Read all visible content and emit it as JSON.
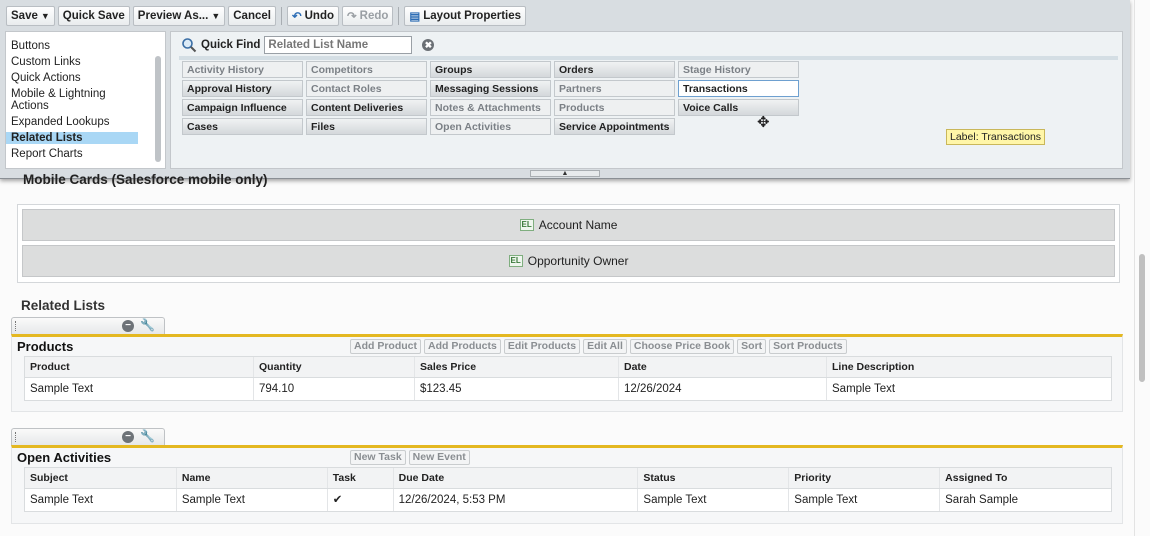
{
  "toolbar": {
    "save": "Save",
    "quick_save": "Quick Save",
    "preview_as": "Preview As...",
    "cancel": "Cancel",
    "undo": "Undo",
    "redo": "Redo",
    "layout_properties": "Layout Properties"
  },
  "palette": {
    "categories": [
      "Buttons",
      "Custom Links",
      "Quick Actions",
      "Mobile & Lightning Actions",
      "Expanded Lookups",
      "Related Lists",
      "Report Charts"
    ],
    "selected_category": "Related Lists",
    "quick_find_label": "Quick Find",
    "quick_find_placeholder": "Related List Name",
    "items": [
      [
        "Activity History",
        "Competitors",
        "Groups",
        "Orders",
        "Stage History"
      ],
      [
        "Approval History",
        "Contact Roles",
        "Messaging Sessions",
        "Partners",
        "Transactions"
      ],
      [
        "Campaign Influence",
        "Content Deliveries",
        "Notes & Attachments",
        "Products",
        "Voice Calls"
      ],
      [
        "Cases",
        "Files",
        "Open Activities",
        "Service Appointments",
        ""
      ]
    ],
    "item_states": [
      [
        "used",
        "used",
        "avail",
        "avail",
        "used"
      ],
      [
        "avail",
        "used",
        "avail",
        "used",
        "active"
      ],
      [
        "avail",
        "avail",
        "used",
        "used",
        "avail"
      ],
      [
        "avail",
        "avail",
        "used",
        "avail",
        ""
      ]
    ],
    "tooltip": "Label: Transactions"
  },
  "mobile_cards": {
    "title": "Mobile Cards (Salesforce mobile only)",
    "fields": [
      "Account Name",
      "Opportunity Owner"
    ],
    "field_icon": "EL"
  },
  "related_lists": {
    "title": "Related Lists",
    "products": {
      "name": "Products",
      "buttons": [
        "Add Product",
        "Add Products",
        "Edit Products",
        "Edit All",
        "Choose Price Book",
        "Sort",
        "Sort Products"
      ],
      "columns": [
        "Product",
        "Quantity",
        "Sales Price",
        "Date",
        "Line Description"
      ],
      "row": [
        "Sample Text",
        "794.10",
        "$123.45",
        "12/26/2024",
        "Sample Text"
      ]
    },
    "open_activities": {
      "name": "Open Activities",
      "buttons": [
        "New Task",
        "New Event"
      ],
      "columns": [
        "Subject",
        "Name",
        "Task",
        "Due Date",
        "Status",
        "Priority",
        "Assigned To"
      ],
      "row": [
        "Sample Text",
        "Sample Text",
        "✔",
        "12/26/2024, 5:53 PM",
        "Sample Text",
        "Sample Text",
        "Sarah Sample"
      ]
    }
  },
  "colors": {
    "accent": "#e4b821",
    "selected": "#a9d7f5",
    "tooltip": "#fff6a8"
  }
}
